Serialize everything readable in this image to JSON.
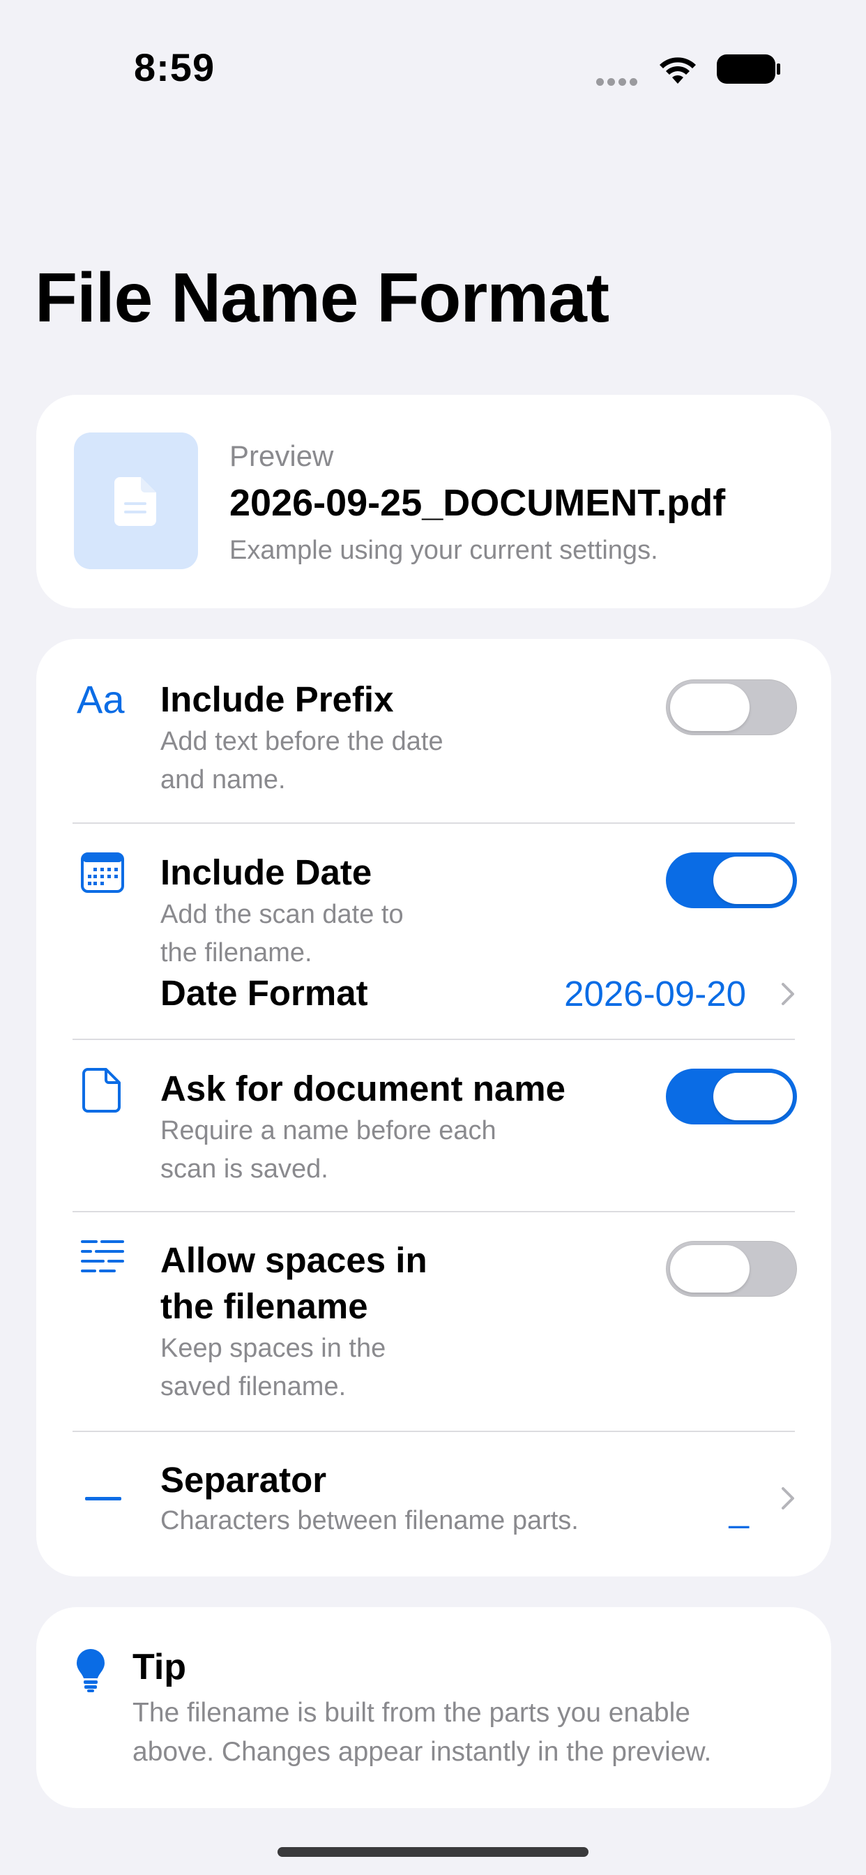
{
  "status_bar": {
    "time": "8:59"
  },
  "title": "File Name Format",
  "preview": {
    "label": "Preview",
    "filename": "2026-09-25_DOCUMENT.pdf",
    "subtitle": "Example using your current settings."
  },
  "settings": {
    "prefix": {
      "title": "Include Prefix",
      "subtitle_line1": "Add text before the date",
      "subtitle_line2": "and name.",
      "enabled": false,
      "icon": "text-aa-icon"
    },
    "date": {
      "title": "Include Date",
      "subtitle_line1": "Add the scan date to",
      "subtitle_line2": "the filename.",
      "enabled": true,
      "icon": "calendar-icon",
      "format_label": "Date Format",
      "format_value": "2026-09-20"
    },
    "ask_name": {
      "title": "Ask for document name",
      "subtitle_line1": "Require a name before each",
      "subtitle_line2": "scan is saved.",
      "enabled": true,
      "icon": "document-icon"
    },
    "spaces": {
      "title_line1": "Allow spaces in",
      "title_line2": "the filename",
      "subtitle_line1": "Keep spaces in the",
      "subtitle_line2": "saved filename.",
      "enabled": false,
      "icon": "text-lines-icon"
    },
    "separator": {
      "title": "Separator",
      "subtitle": "Characters between filename parts.",
      "value": "_",
      "icon": "dash-icon"
    }
  },
  "tip": {
    "title": "Tip",
    "body_line1": "The filename is built from the parts you enable",
    "body_line2": "above. Changes appear instantly in the preview.",
    "icon": "lightbulb-icon"
  },
  "colors": {
    "accent": "#0a6ce5",
    "background": "#f2f2f7",
    "secondary_text": "#8a8a8e",
    "toggle_off": "#c7c7cc"
  }
}
